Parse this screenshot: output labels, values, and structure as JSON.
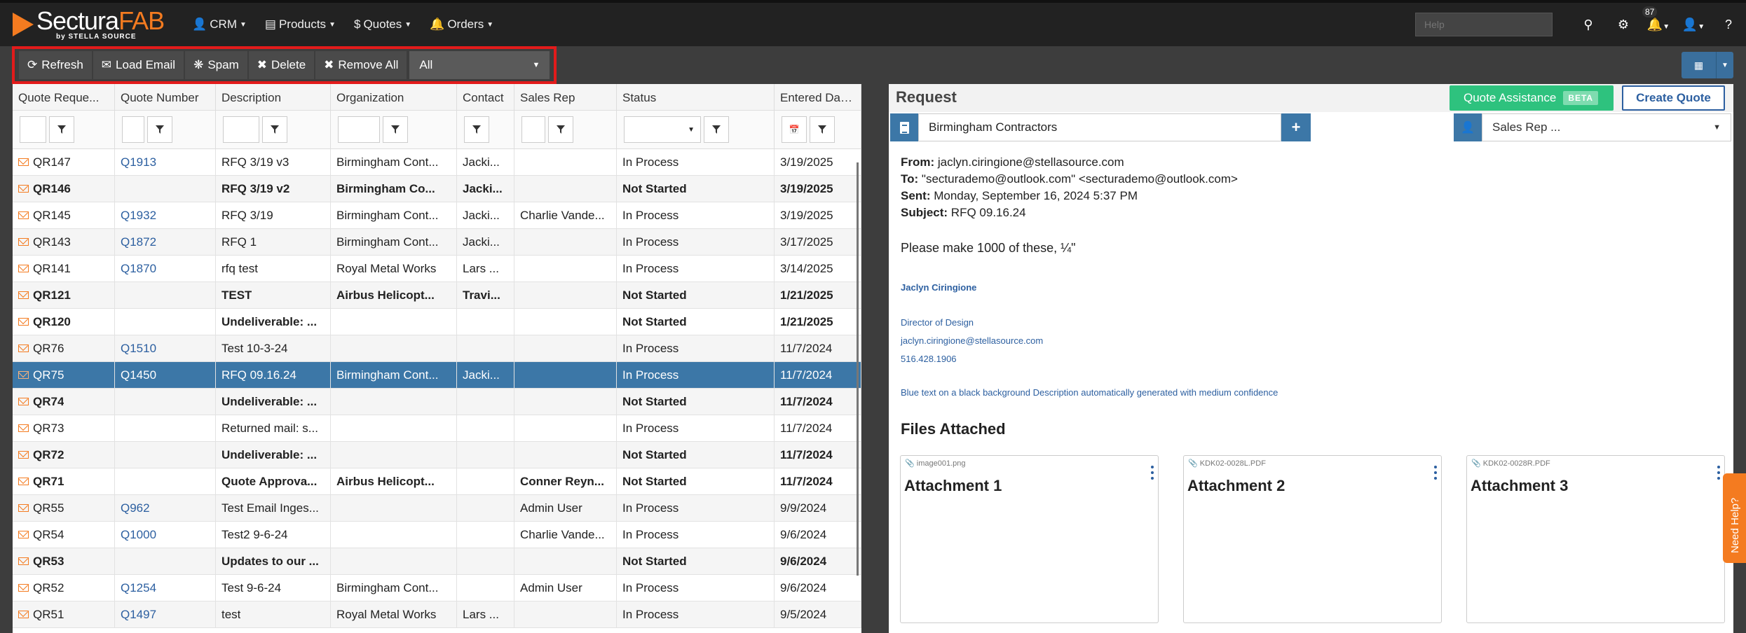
{
  "brand": {
    "name_main": "Sectura",
    "name_accent": "FAB",
    "sub": "by STELLA SOURCE"
  },
  "nav": {
    "items": [
      {
        "icon": "user-icon",
        "label": "CRM"
      },
      {
        "icon": "barcode-icon",
        "label": "Products"
      },
      {
        "icon": "dollar-icon",
        "label": "Quotes"
      },
      {
        "icon": "bell-icon",
        "label": "Orders"
      }
    ],
    "help_placeholder": "Help",
    "notification_count": "87"
  },
  "toolbar": {
    "refresh": "Refresh",
    "load_email": "Load Email",
    "spam": "Spam",
    "delete": "Delete",
    "remove_all": "Remove All",
    "filter_value": "All"
  },
  "grid": {
    "columns": [
      "Quote Reque...",
      "Quote Number",
      "Description",
      "Organization",
      "Contact",
      "Sales Rep",
      "Status",
      "Entered Date..."
    ],
    "rows": [
      {
        "id": "QR147",
        "quote": "Q1913",
        "desc": "RFQ 3/19 v3",
        "org": "Birmingham Cont...",
        "contact": "Jacki...",
        "rep": "",
        "status": "In Process",
        "date": "3/19/2025",
        "bold": false,
        "selected": false
      },
      {
        "id": "QR146",
        "quote": "",
        "desc": "RFQ 3/19 v2",
        "org": "Birmingham Co...",
        "contact": "Jacki...",
        "rep": "",
        "status": "Not Started",
        "date": "3/19/2025",
        "bold": true,
        "selected": false
      },
      {
        "id": "QR145",
        "quote": "Q1932",
        "desc": "RFQ 3/19",
        "org": "Birmingham Cont...",
        "contact": "Jacki...",
        "rep": "Charlie Vande...",
        "status": "In Process",
        "date": "3/19/2025",
        "bold": false,
        "selected": false
      },
      {
        "id": "QR143",
        "quote": "Q1872",
        "desc": "RFQ 1",
        "org": "Birmingham Cont...",
        "contact": "Jacki...",
        "rep": "",
        "status": "In Process",
        "date": "3/17/2025",
        "bold": false,
        "selected": false
      },
      {
        "id": "QR141",
        "quote": "Q1870",
        "desc": "rfq test",
        "org": "Royal Metal Works",
        "contact": "Lars ...",
        "rep": "",
        "status": "In Process",
        "date": "3/14/2025",
        "bold": false,
        "selected": false
      },
      {
        "id": "QR121",
        "quote": "",
        "desc": "TEST",
        "org": "Airbus Helicopt...",
        "contact": "Travi...",
        "rep": "",
        "status": "Not Started",
        "date": "1/21/2025",
        "bold": true,
        "selected": false
      },
      {
        "id": "QR120",
        "quote": "",
        "desc": "Undeliverable: ...",
        "org": "",
        "contact": "",
        "rep": "",
        "status": "Not Started",
        "date": "1/21/2025",
        "bold": true,
        "selected": false
      },
      {
        "id": "QR76",
        "quote": "Q1510",
        "desc": "Test 10-3-24",
        "org": "",
        "contact": "",
        "rep": "",
        "status": "In Process",
        "date": "11/7/2024",
        "bold": false,
        "selected": false
      },
      {
        "id": "QR75",
        "quote": "Q1450",
        "desc": "RFQ 09.16.24",
        "org": "Birmingham Cont...",
        "contact": "Jacki...",
        "rep": "",
        "status": "In Process",
        "date": "11/7/2024",
        "bold": false,
        "selected": true
      },
      {
        "id": "QR74",
        "quote": "",
        "desc": "Undeliverable: ...",
        "org": "",
        "contact": "",
        "rep": "",
        "status": "Not Started",
        "date": "11/7/2024",
        "bold": true,
        "selected": false
      },
      {
        "id": "QR73",
        "quote": "",
        "desc": "Returned mail: s...",
        "org": "",
        "contact": "",
        "rep": "",
        "status": "In Process",
        "date": "11/7/2024",
        "bold": false,
        "selected": false
      },
      {
        "id": "QR72",
        "quote": "",
        "desc": "Undeliverable: ...",
        "org": "",
        "contact": "",
        "rep": "",
        "status": "Not Started",
        "date": "11/7/2024",
        "bold": true,
        "selected": false
      },
      {
        "id": "QR71",
        "quote": "",
        "desc": "Quote Approva...",
        "org": "Airbus Helicopt...",
        "contact": "",
        "rep": "Conner Reyn...",
        "status": "Not Started",
        "date": "11/7/2024",
        "bold": true,
        "selected": false
      },
      {
        "id": "QR55",
        "quote": "Q962",
        "desc": "Test Email Inges...",
        "org": "",
        "contact": "",
        "rep": "Admin User",
        "status": "In Process",
        "date": "9/9/2024",
        "bold": false,
        "selected": false
      },
      {
        "id": "QR54",
        "quote": "Q1000",
        "desc": "Test2 9-6-24",
        "org": "",
        "contact": "",
        "rep": "Charlie Vande...",
        "status": "In Process",
        "date": "9/6/2024",
        "bold": false,
        "selected": false
      },
      {
        "id": "QR53",
        "quote": "",
        "desc": "Updates to our ...",
        "org": "",
        "contact": "",
        "rep": "",
        "status": "Not Started",
        "date": "9/6/2024",
        "bold": true,
        "selected": false
      },
      {
        "id": "QR52",
        "quote": "Q1254",
        "desc": "Test 9-6-24",
        "org": "Birmingham Cont...",
        "contact": "",
        "rep": "Admin User",
        "status": "In Process",
        "date": "9/6/2024",
        "bold": false,
        "selected": false
      },
      {
        "id": "QR51",
        "quote": "Q1497",
        "desc": "test",
        "org": "Royal Metal Works",
        "contact": "Lars ...",
        "rep": "",
        "status": "In Process",
        "date": "9/5/2024",
        "bold": false,
        "selected": false
      }
    ]
  },
  "request": {
    "title": "Request",
    "quote_assistance": "Quote Assistance",
    "beta": "BETA",
    "create_quote": "Create Quote",
    "organization": "Birmingham Contractors",
    "sales_rep_placeholder": "Sales Rep ...",
    "email": {
      "from_label": "From:",
      "from": "jaclyn.ciringione@stellasource.com",
      "to_label": "To:",
      "to": "\"secturademo@outlook.com\" <secturademo@outlook.com>",
      "sent_label": "Sent:",
      "sent": "Monday, September 16, 2024 5:37 PM",
      "subject_label": "Subject:",
      "subject": "RFQ 09.16.24",
      "body": "Please make 1000 of these, ¼\"",
      "sig_name": "Jaclyn Ciringione",
      "sig_title": "Director of Design",
      "sig_email": "jaclyn.ciringione@stellasource.com",
      "sig_phone": "516.428.1906",
      "sig_alt": "Blue text on a black background Description automatically generated with medium confidence"
    },
    "files_title": "Files Attached",
    "attachments": [
      {
        "file": "image001.png",
        "title": "Attachment 1"
      },
      {
        "file": "KDK02-0028L.PDF",
        "title": "Attachment 2"
      },
      {
        "file": "KDK02-0028R.PDF",
        "title": "Attachment 3"
      }
    ]
  },
  "need_help": "Need Help?",
  "colors": {
    "accent_orange": "#f47b20",
    "selected_row": "#3c77a7",
    "green_button": "#2ec27e",
    "highlight_red": "#e21b1b"
  }
}
